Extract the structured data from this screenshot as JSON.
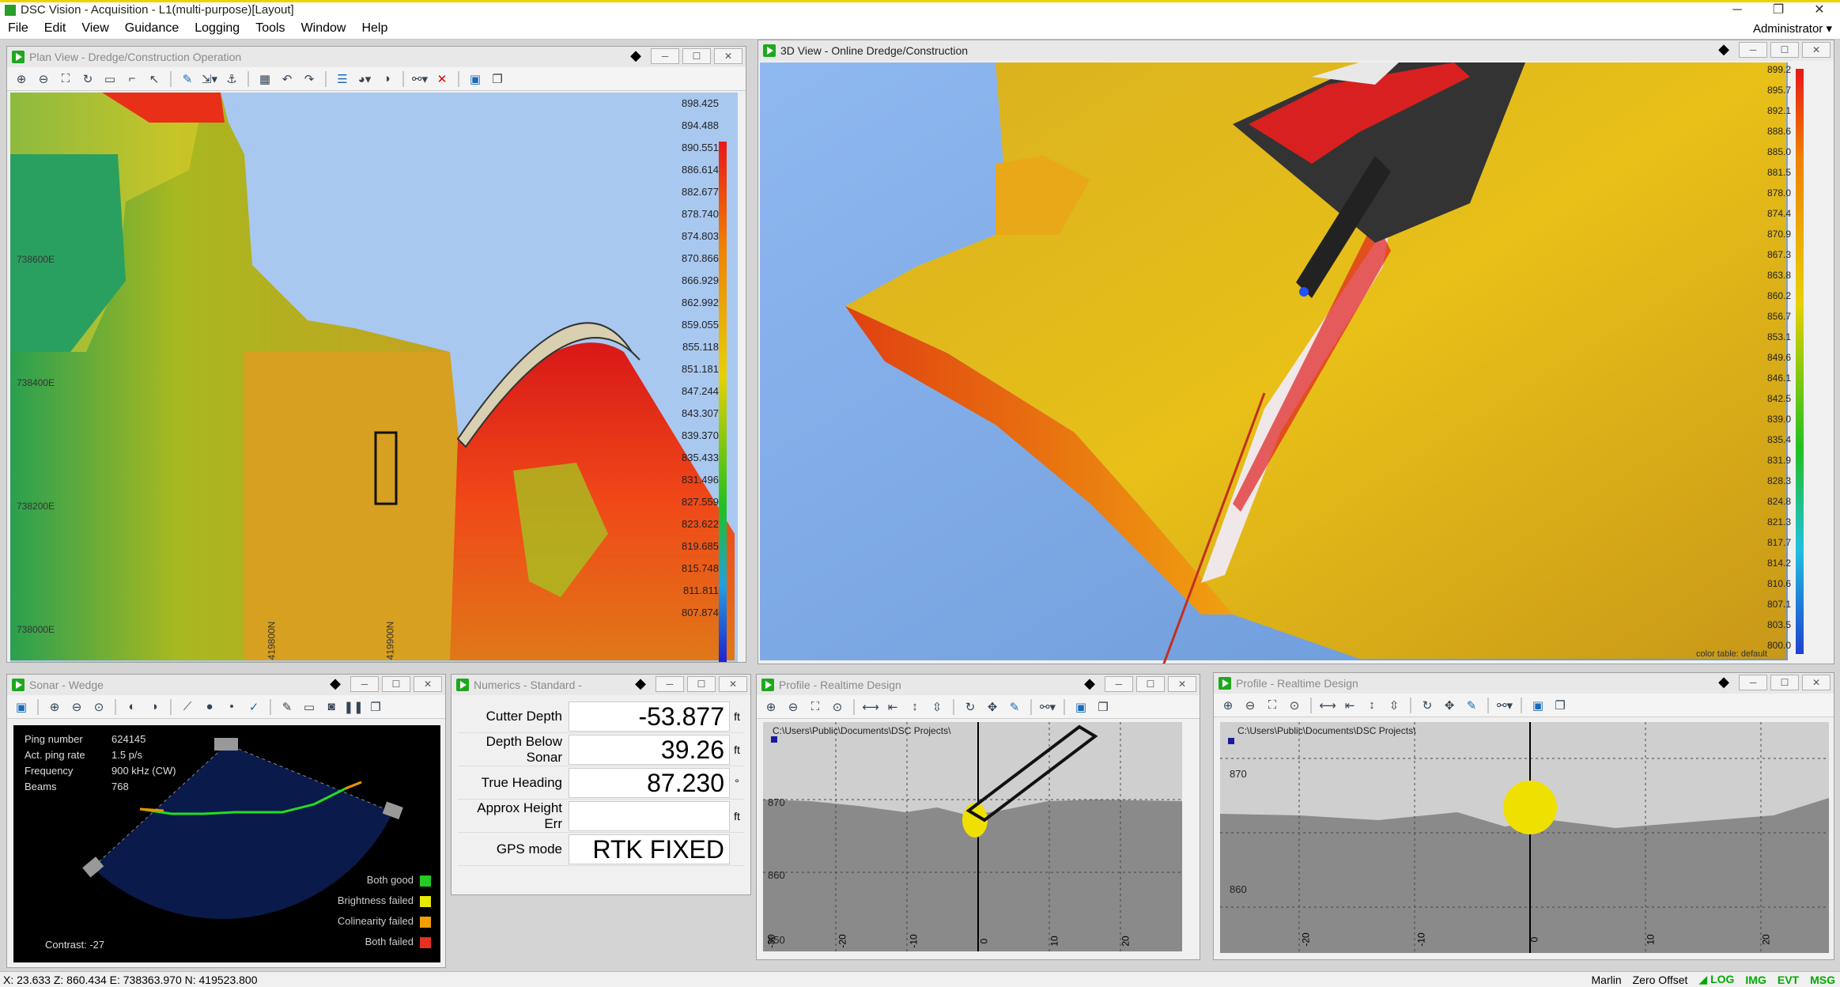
{
  "window": {
    "title": "DSC Vision - Acquisition - L1(multi-purpose)[Layout]",
    "user": "Administrator"
  },
  "menu": [
    "File",
    "Edit",
    "View",
    "Guidance",
    "Logging",
    "Tools",
    "Window",
    "Help"
  ],
  "plan_view": {
    "title": "Plan View - Dredge/Construction Operation",
    "scale": [
      "898.425",
      "894.488",
      "890.551",
      "886.614",
      "882.677",
      "878.740",
      "874.803",
      "870.866",
      "866.929",
      "862.992",
      "859.055",
      "855.118",
      "851.181",
      "847.244",
      "843.307",
      "839.370",
      "835.433",
      "831.496",
      "827.559",
      "823.622",
      "819.685",
      "815.748",
      "811.811",
      "807.874"
    ],
    "grid_e": [
      "738600E",
      "738400E",
      "738200E",
      "738000E"
    ],
    "grid_n": [
      "419800N",
      "419900N"
    ]
  },
  "view3d": {
    "title": "3D View - Online Dredge/Construction",
    "scale": [
      "899.2",
      "895.7",
      "892.1",
      "888.6",
      "885.0",
      "881.5",
      "878.0",
      "874.4",
      "870.9",
      "867.3",
      "863.8",
      "860.2",
      "856.7",
      "853.1",
      "849.6",
      "846.1",
      "842.5",
      "839.0",
      "835.4",
      "831.9",
      "828.3",
      "824.8",
      "821.3",
      "817.7",
      "814.2",
      "810.6",
      "807.1",
      "803.5",
      "800.0"
    ],
    "color_table": "color table: default"
  },
  "sonar": {
    "title": "Sonar - Wedge",
    "info": [
      {
        "k": "Ping number",
        "v": "624145"
      },
      {
        "k": "Act. ping rate",
        "v": "1.5 p/s"
      },
      {
        "k": "Frequency",
        "v": "900 kHz (CW)"
      },
      {
        "k": "Beams",
        "v": "768"
      }
    ],
    "legend": [
      {
        "label": "Both good",
        "color": "#22cc22"
      },
      {
        "label": "Brightness failed",
        "color": "#e8e800"
      },
      {
        "label": "Colinearity failed",
        "color": "#f0a000"
      },
      {
        "label": "Both failed",
        "color": "#e83020"
      }
    ],
    "contrast": "Contrast: -27"
  },
  "numerics": {
    "title": "Numerics - Standard -",
    "rows": [
      {
        "label": "Cutter Depth",
        "value": "-53.877",
        "unit": "ft"
      },
      {
        "label": "Depth Below Sonar",
        "value": "39.26",
        "unit": "ft"
      },
      {
        "label": "True Heading",
        "value": "87.230",
        "unit": "°"
      },
      {
        "label": "Approx Height Err",
        "value": "",
        "unit": "ft"
      },
      {
        "label": "GPS mode",
        "value": "RTK FIXED",
        "unit": ""
      }
    ]
  },
  "profile1": {
    "title": "Profile - Realtime Design",
    "path": "C:\\Users\\Public\\Documents\\DSC Projects\\",
    "y_labels": [
      "870",
      "860",
      "850"
    ],
    "x_labels": [
      "-30",
      "-20",
      "-10",
      "0",
      "10",
      "20"
    ]
  },
  "profile2": {
    "title": "Profile - Realtime Design",
    "path": "C:\\Users\\Public\\Documents\\DSC Projects\\",
    "y_labels": [
      "870",
      "860"
    ],
    "x_labels": [
      "-20",
      "-10",
      "0",
      "10",
      "20"
    ]
  },
  "status": {
    "coords": "X: 23.633 Z: 860.434 E: 738363.970 N: 419523.800",
    "vessel": "Marlin",
    "offset": "Zero Offset",
    "indicators": [
      "LOG",
      "IMG",
      "EVT",
      "MSG"
    ]
  },
  "colors": {
    "accent": "#1ea81e",
    "water": "#a8c8f0"
  }
}
